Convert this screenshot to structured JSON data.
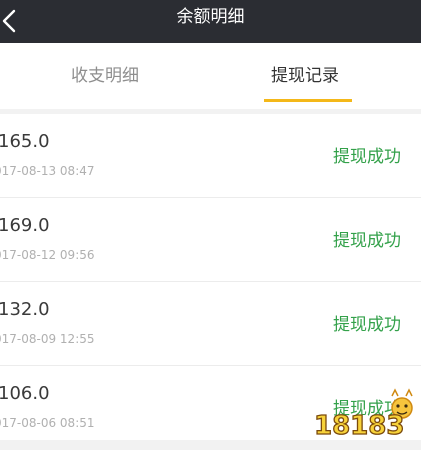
{
  "header": {
    "title": "余额明细"
  },
  "tabs": [
    {
      "label": "收支明细",
      "active": false
    },
    {
      "label": "提现记录",
      "active": true
    }
  ],
  "records": [
    {
      "amount": "165.0",
      "time": "017-08-13 08:47",
      "status": "提现成功"
    },
    {
      "amount": "169.0",
      "time": "017-08-12 09:56",
      "status": "提现成功"
    },
    {
      "amount": "132.0",
      "time": "017-08-09 12:55",
      "status": "提现成功"
    },
    {
      "amount": "106.0",
      "time": "017-08-06 08:51",
      "status": "提现成功"
    }
  ],
  "watermark": {
    "text": "18183"
  },
  "colors": {
    "header_bg": "#2b2d33",
    "tab_indicator": "#f4b819",
    "status_success": "#33a14a"
  }
}
